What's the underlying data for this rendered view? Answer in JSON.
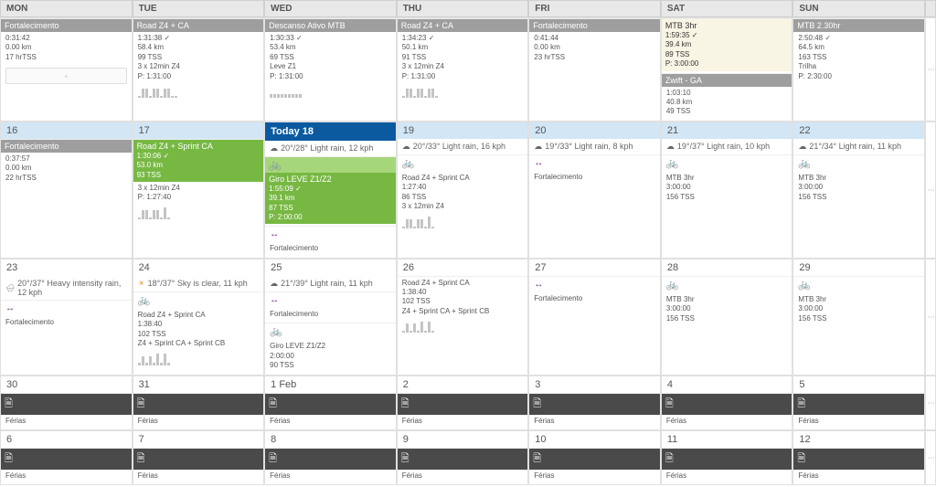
{
  "days_header": [
    "MON",
    "TUE",
    "WED",
    "THU",
    "FRI",
    "SAT",
    "SUN"
  ],
  "today_label": "Today 18",
  "row0": {
    "mon": {
      "title": "Fortalecimento",
      "l1": "0:31:42",
      "l2": "0.00 km",
      "l3": "17 hrTSS"
    },
    "tue": {
      "title": "Road Z4 + CA",
      "l1": "1:31:38 ✓",
      "l2": "58.4 km",
      "l3": "99 TSS",
      "extra": "3 x 12min Z4",
      "p": "P: 1:31:00"
    },
    "wed": {
      "title": "Descanso Ativo MTB",
      "l1": "1:30:33 ✓",
      "l2": "53.4 km",
      "l3": "69 TSS",
      "extra": "Leve Z1",
      "p": "P: 1:31:00"
    },
    "thu": {
      "title": "Road Z4 + CA",
      "l1": "1:34:23 ✓",
      "l2": "50.1 km",
      "l3": "91 TSS",
      "extra": "3 x 12min Z4",
      "p": "P: 1:31:00"
    },
    "fri": {
      "title": "Fortalecimento",
      "l1": "0:41:44",
      "l2": "0.00 km",
      "l3": "23 hrTSS"
    },
    "sat": {
      "title": "MTB 3hr",
      "l1": "1:59:35 ✓",
      "l2": "39.4 km",
      "l3": "89 TSS",
      "p": "P: 3:00:00",
      "zwift_title": "Zwift - GA",
      "zl1": "1:03:10",
      "zl2": "40.8 km",
      "zl3": "49 TSS"
    },
    "sun": {
      "title": "MTB 2.30hr",
      "l1": "2:50:48 ✓",
      "l2": "64.5 km",
      "l3": "163 TSS",
      "extra": "Trilha",
      "p": "P: 2:30:00"
    }
  },
  "row1": {
    "d16": "16",
    "d17": "17",
    "d19": "19",
    "d20": "20",
    "d21": "21",
    "d22": "22",
    "mon": {
      "title": "Fortalecimento",
      "l1": "0:37:57",
      "l2": "0.00 km",
      "l3": "22 hrTSS"
    },
    "tue": {
      "title": "Road Z4 + Sprint CA",
      "l1": "1:30:06 ✓",
      "l2": "53.0 km",
      "l3": "93 TSS",
      "extra": "3 x 12min Z4",
      "p": "P: 1:27:40"
    },
    "wed": {
      "weather": "20°/28° Light rain, 12 kph",
      "title": "Giro LEVE Z1/Z2",
      "l1": "1:55:09 ✓",
      "l2": "39.1 km",
      "l3": "87 TSS",
      "p": "P: 2:00:00",
      "strength": "Fortalecimento"
    },
    "thu": {
      "weather": "20°/33° Light rain, 16 kph",
      "title": "Road Z4 + Sprint CA",
      "l1": "1:27:40",
      "l2": "86 TSS",
      "extra": "3 x 12min Z4"
    },
    "fri": {
      "weather": "19°/33° Light rain, 8 kph",
      "title": "Fortalecimento"
    },
    "sat": {
      "weather": "19°/37° Light rain, 10 kph",
      "title": "MTB 3hr",
      "l1": "3:00:00",
      "l2": "156 TSS"
    },
    "sun": {
      "weather": "21°/34° Light rain, 11 kph",
      "title": "MTB 3hr",
      "l1": "3:00:00",
      "l2": "156 TSS"
    }
  },
  "row2": {
    "d23": "23",
    "d24": "24",
    "d25": "25",
    "d26": "26",
    "d27": "27",
    "d28": "28",
    "d29": "29",
    "mon": {
      "weather": "20°/37° Heavy intensity rain, 12 kph",
      "title": "Fortalecimento"
    },
    "tue": {
      "weather": "18°/37° Sky is clear, 11 kph",
      "title": "Road Z4 + Sprint CA",
      "l1": "1:38:40",
      "l2": "102 TSS",
      "extra": "Z4 + Sprint CA + Sprint CB"
    },
    "wed": {
      "weather": "21°/39° Light rain, 11 kph",
      "title": "Fortalecimento",
      "giro": "Giro LEVE Z1/Z2",
      "gl1": "2:00:00",
      "gl2": "90 TSS"
    },
    "thu": {
      "title": "Road Z4 + Sprint CA",
      "l1": "1:38:40",
      "l2": "102 TSS",
      "extra": "Z4 + Sprint CA + Sprint CB"
    },
    "fri": {
      "title": "Fortalecimento"
    },
    "sat": {
      "title": "MTB 3hr",
      "l1": "3:00:00",
      "l2": "156 TSS"
    },
    "sun": {
      "title": "MTB 3hr",
      "l1": "3:00:00",
      "l2": "156 TSS"
    }
  },
  "row3": {
    "d30": "30",
    "d31": "31",
    "feb": "1 Feb",
    "d2": "2",
    "d3": "3",
    "d4": "4",
    "d5": "5",
    "ferias": "Férias"
  },
  "row4": {
    "d6": "6",
    "d7": "7",
    "d8": "8",
    "d9": "9",
    "d10": "10",
    "d11": "11",
    "d12": "12",
    "ferias": "Férias"
  }
}
